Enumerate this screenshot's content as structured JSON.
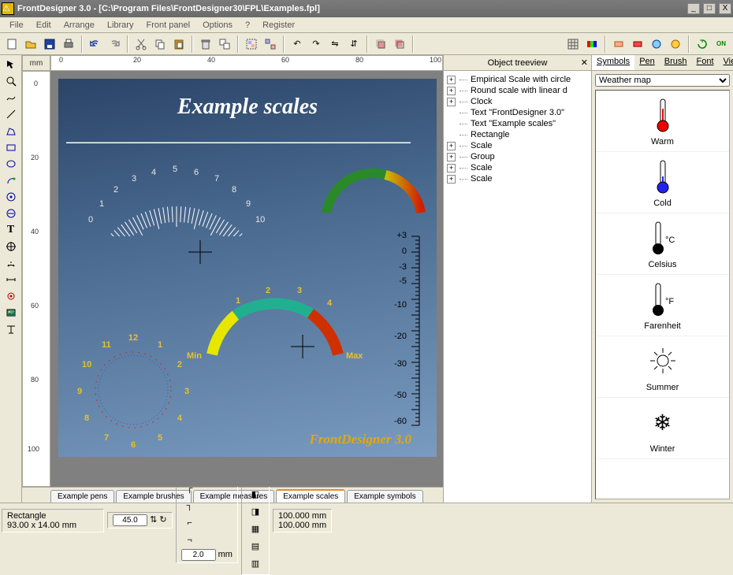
{
  "window": {
    "title": "FrontDesigner 3.0 - [C:\\Program Files\\FrontDesigner30\\FPL\\Examples.fpl]"
  },
  "menubar": [
    "File",
    "Edit",
    "Arrange",
    "Library",
    "Front panel",
    "Options",
    "?",
    "Register"
  ],
  "ruler": {
    "unit": "mm",
    "marks": [
      0,
      20,
      40,
      60,
      80,
      100
    ],
    "vmarks": [
      0,
      20,
      40,
      60,
      80,
      100
    ]
  },
  "canvas": {
    "title": "Example scales",
    "brand": "FrontDesigner 3.0",
    "arc1_nums": [
      "0",
      "1",
      "2",
      "3",
      "4",
      "5",
      "6",
      "7",
      "8",
      "9",
      "10"
    ],
    "arc3": {
      "nums": [
        "1",
        "2",
        "3",
        "4"
      ],
      "min": "Min",
      "max": "Max"
    },
    "clock_nums": [
      "12",
      "1",
      "2",
      "3",
      "4",
      "5",
      "6",
      "7",
      "8",
      "9",
      "10",
      "11"
    ],
    "therm_marks": [
      "+3",
      "0",
      "-3",
      "-5",
      "-10",
      "-20",
      "-30",
      "-50",
      "-60"
    ]
  },
  "tabs": {
    "items": [
      "Example pens",
      "Example brushes",
      "Example measures",
      "Example scales",
      "Example symbols"
    ],
    "active": 3
  },
  "treeview": {
    "title": "Object treeview",
    "items": [
      {
        "exp": true,
        "label": "Empirical Scale with circle"
      },
      {
        "exp": true,
        "label": "Round scale with linear d"
      },
      {
        "exp": true,
        "label": "Clock"
      },
      {
        "exp": false,
        "label": "Text \"FrontDesigner 3.0\""
      },
      {
        "exp": false,
        "label": "Text \"Example scales\""
      },
      {
        "exp": false,
        "label": "Rectangle"
      },
      {
        "exp": true,
        "label": "Scale"
      },
      {
        "exp": true,
        "label": "Group"
      },
      {
        "exp": true,
        "label": "Scale"
      },
      {
        "exp": true,
        "label": "Scale"
      }
    ]
  },
  "rightpanel": {
    "tabs": [
      "Symbols",
      "Pen",
      "Brush",
      "Font",
      "View"
    ],
    "dropdown": "Weather map",
    "symbols": [
      "Warm",
      "Cold",
      "Celsius",
      "Farenheit",
      "Summer",
      "Winter"
    ]
  },
  "status": {
    "object": "Rectangle",
    "dimensions": "93.00 x 14.00 mm",
    "val1": "45.0",
    "val2": "2.0",
    "unit": "mm",
    "coord1": "100.000",
    "coord2": "100.000",
    "coord_unit": "mm"
  }
}
